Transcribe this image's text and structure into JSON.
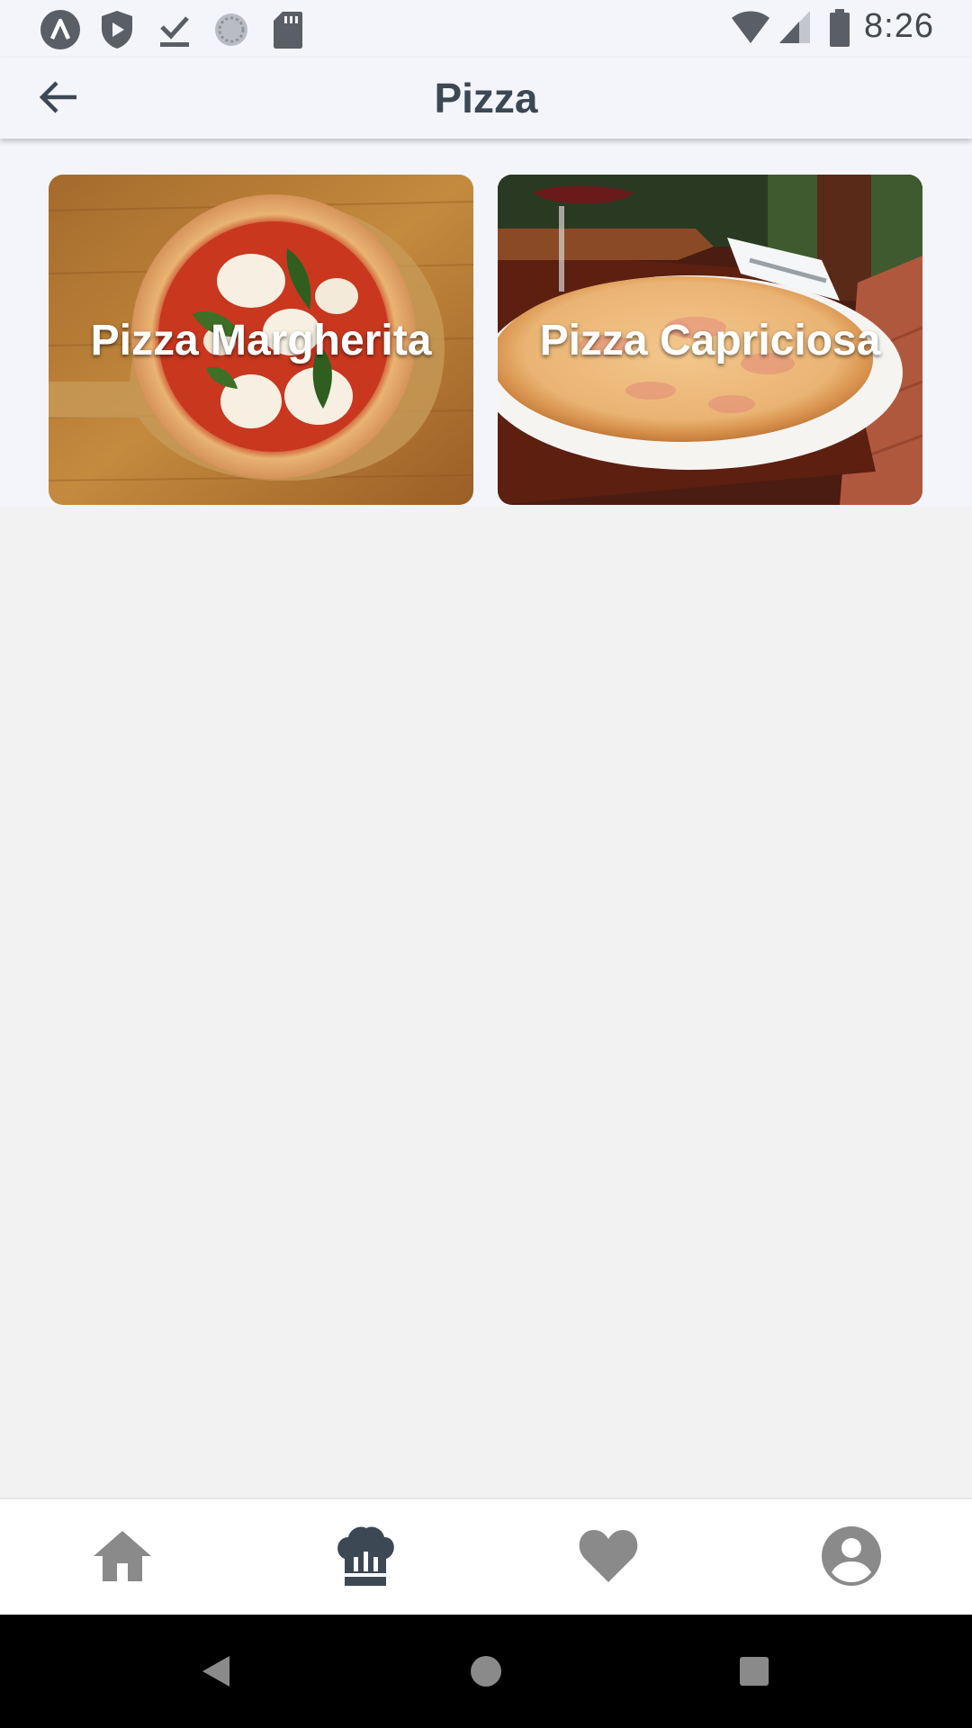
{
  "status_bar": {
    "time": "8:26",
    "left_icons": [
      "launcher-a-icon",
      "shield-play-icon",
      "download-done-icon",
      "sync-circle-icon",
      "sd-card-icon"
    ],
    "right_icons": [
      "wifi-icon",
      "cellular-signal-icon",
      "battery-icon"
    ]
  },
  "app_bar": {
    "title": "Pizza",
    "back_icon": "arrow-back-icon"
  },
  "cards": [
    {
      "label": "Pizza Margherita"
    },
    {
      "label": "Pizza Capriciosa"
    }
  ],
  "bottom_nav": {
    "items": [
      {
        "icon": "home-icon",
        "active": false
      },
      {
        "icon": "chef-hat-icon",
        "active": true
      },
      {
        "icon": "heart-icon",
        "active": false
      },
      {
        "icon": "account-icon",
        "active": false
      }
    ],
    "active_color": "#3c4854",
    "inactive_color": "#8a8a8a"
  },
  "system_nav": {
    "items": [
      "back-triangle-icon",
      "home-circle-icon",
      "recents-square-icon"
    ]
  }
}
